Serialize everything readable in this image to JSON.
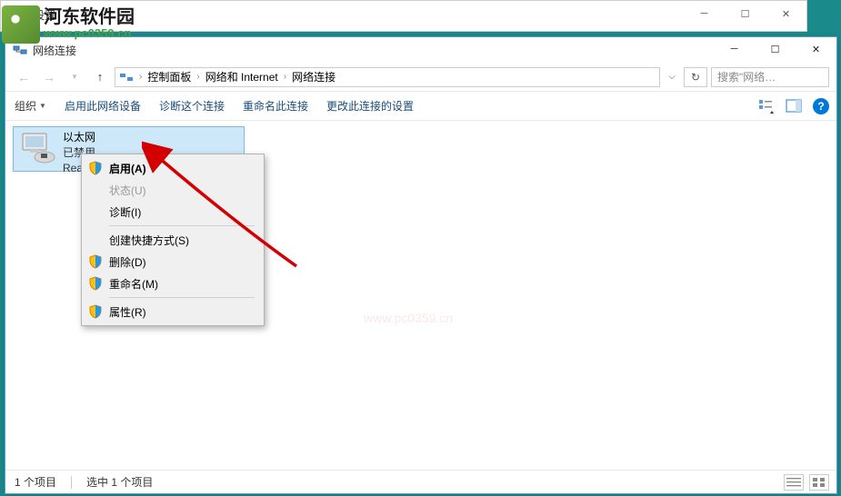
{
  "bgWindow": {
    "title": "设置"
  },
  "watermark": {
    "cn": "河东软件园",
    "url": "www.pc0359.cn",
    "center": "www.pc0359.cn"
  },
  "explorer": {
    "title": "网络连接",
    "path": {
      "seg1": "控制面板",
      "seg2": "网络和 Internet",
      "seg3": "网络连接"
    },
    "search_placeholder": "搜索\"网络…",
    "toolbar": {
      "organize": "组织",
      "enable": "启用此网络设备",
      "diagnose": "诊断这个连接",
      "rename": "重命名此连接",
      "change": "更改此连接的设置"
    },
    "adapter": {
      "name": "以太网",
      "status": "已禁用",
      "device": "Rea"
    },
    "contextMenu": {
      "enable": "启用(A)",
      "status": "状态(U)",
      "diagnose": "诊断(I)",
      "shortcut": "创建快捷方式(S)",
      "delete": "删除(D)",
      "rename": "重命名(M)",
      "properties": "属性(R)"
    },
    "status": {
      "itemCount": "1 个项目",
      "selected": "选中 1 个项目"
    }
  }
}
